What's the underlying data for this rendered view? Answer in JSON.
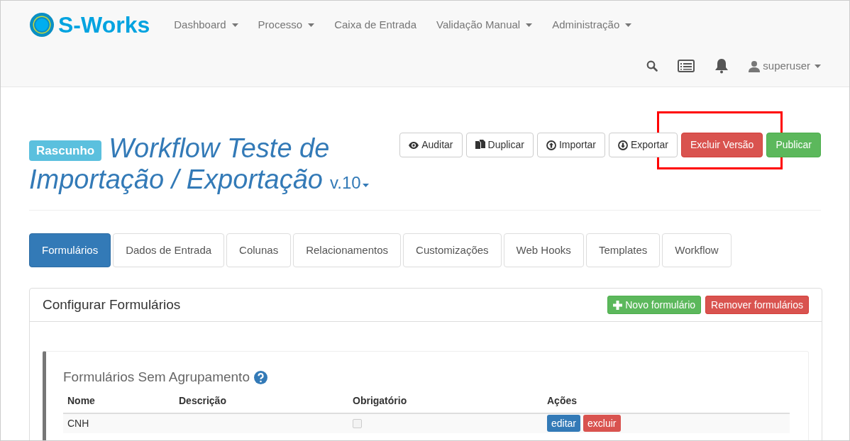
{
  "brand": {
    "name": "S-Works"
  },
  "nav": [
    {
      "label": "Dashboard",
      "dropdown": true
    },
    {
      "label": "Processo",
      "dropdown": true
    },
    {
      "label": "Caixa de Entrada",
      "dropdown": false
    },
    {
      "label": "Validação Manual",
      "dropdown": true
    },
    {
      "label": "Administração",
      "dropdown": true
    }
  ],
  "user": {
    "name": "superuser"
  },
  "header": {
    "status_badge": "Rascunho",
    "title_lines": [
      "Workflow Teste de",
      "Importação / Exportação"
    ],
    "version": "v.10"
  },
  "actions": [
    {
      "label": "Auditar",
      "kind": "default"
    },
    {
      "label": "Duplicar",
      "kind": "default"
    },
    {
      "label": "Importar",
      "kind": "default"
    },
    {
      "label": "Exportar",
      "kind": "default"
    },
    {
      "label": "Excluir Versão",
      "kind": "danger"
    },
    {
      "label": "Publicar",
      "kind": "success"
    }
  ],
  "tabs": [
    {
      "label": "Formulários",
      "selected": true
    },
    {
      "label": "Dados de Entrada",
      "selected": false
    },
    {
      "label": "Colunas",
      "selected": false
    },
    {
      "label": "Relacionamentos",
      "selected": false
    },
    {
      "label": "Customizações",
      "selected": false
    },
    {
      "label": "Web Hooks",
      "selected": false
    },
    {
      "label": "Templates",
      "selected": false
    },
    {
      "label": "Workflow",
      "selected": false
    }
  ],
  "panel": {
    "title": "Configurar Formulários",
    "buttons": [
      {
        "label": "Novo formulário",
        "kind": "success"
      },
      {
        "label": "Remover formulários",
        "kind": "danger"
      }
    ],
    "group": {
      "title": "Formulários Sem Agrupamento",
      "table": {
        "columns": [
          "Nome",
          "Descrição",
          "Obrigatório",
          "Ações"
        ],
        "rows": [
          {
            "nome": "CNH",
            "descricao": "",
            "obrigatorio": false,
            "actions": [
              "editar",
              "excluir"
            ]
          }
        ]
      }
    }
  }
}
